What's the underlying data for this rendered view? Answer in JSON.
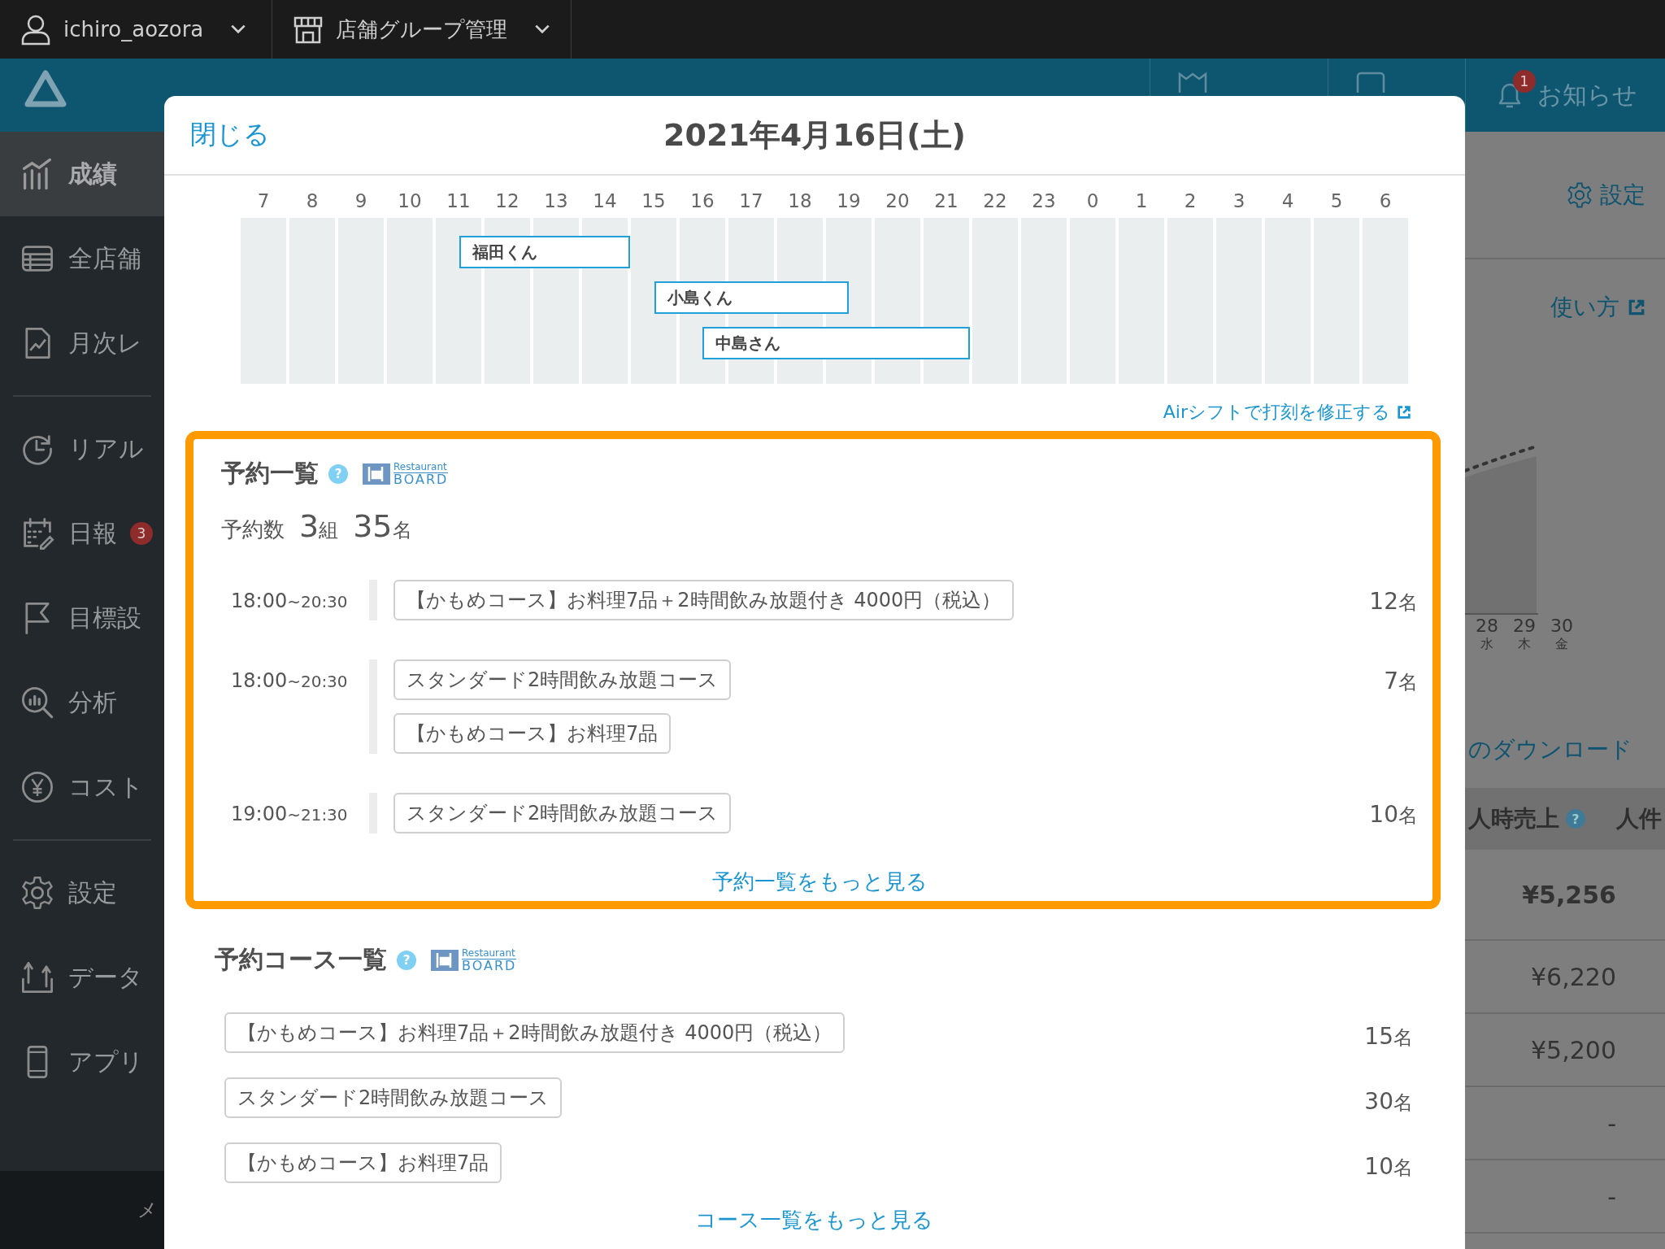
{
  "top_bar": {
    "user": "ichiro_aozora",
    "group": "店舗グループ管理"
  },
  "header": {
    "links": [
      {
        "kind": "guide"
      },
      {
        "kind": "help"
      },
      {
        "label": "お知らせ",
        "kind": "bell",
        "badge": "1"
      }
    ]
  },
  "sidebar": {
    "groups": [
      [
        {
          "label": "成績",
          "kind": "chart",
          "selected": true
        },
        {
          "label": "全店舗",
          "kind": "table",
          "selected": false
        },
        {
          "label": "月次レ",
          "kind": "report",
          "selected": false
        }
      ],
      [
        {
          "label": "リアル",
          "kind": "clock",
          "selected": false
        },
        {
          "label": "日報",
          "kind": "calendar",
          "selected": false,
          "badge": "3"
        },
        {
          "label": "目標設",
          "kind": "flag",
          "selected": false
        },
        {
          "label": "分析",
          "kind": "analysis",
          "selected": false
        },
        {
          "label": "コスト",
          "kind": "yen",
          "selected": false
        }
      ],
      [
        {
          "label": "設定",
          "kind": "gear",
          "selected": false
        },
        {
          "label": "データ",
          "kind": "export",
          "selected": false
        },
        {
          "label": "アプリ",
          "kind": "phone",
          "selected": false
        }
      ]
    ],
    "footer": "メ"
  },
  "background": {
    "settings": "設定",
    "howto": "使い方",
    "days": [
      {
        "day": "28",
        "weekday": "水"
      },
      {
        "day": "29",
        "weekday": "木"
      },
      {
        "day": "30",
        "weekday": "金"
      }
    ],
    "download": "のダウンロード",
    "table": {
      "columns": [
        {
          "label": "人時売上",
          "help": "?"
        },
        {
          "label": "人件"
        }
      ],
      "rows": [
        {
          "value": "¥5,256",
          "kind": "total"
        },
        {
          "value": "¥6,220",
          "kind": "day"
        },
        {
          "value": "¥5,200",
          "kind": "day"
        },
        {
          "value": "-",
          "kind": "day"
        },
        {
          "value": "-",
          "kind": "day"
        }
      ]
    }
  },
  "modal": {
    "close": "閉じる",
    "title": "2021年4月16日(土)",
    "hours": [
      "7",
      "8",
      "9",
      "10",
      "11",
      "12",
      "13",
      "14",
      "15",
      "16",
      "17",
      "18",
      "19",
      "20",
      "21",
      "22",
      "23",
      "0",
      "1",
      "2",
      "3",
      "4",
      "5",
      "6"
    ],
    "shifts": [
      {
        "name": "福田くん"
      },
      {
        "name": "小島くん"
      },
      {
        "name": "中島さん"
      }
    ],
    "shift_link": "Airシフトで打刻を修正する",
    "reservations": {
      "title": "予約一覧",
      "help": "?",
      "highlighted": true,
      "logo": {
        "top": "Restaurant",
        "bottom": "BOARD"
      },
      "summary_label": "予約数",
      "summary": [
        {
          "number": "3",
          "unit": "組"
        },
        {
          "number": "35",
          "unit": "名"
        }
      ],
      "rows": [
        {
          "start": "18:00",
          "end": "~20:30",
          "courses": [
            "【かもめコース】お料理7品＋2時間飲み放題付き 4000円（税込）"
          ],
          "count": "12",
          "unit": "名"
        },
        {
          "start": "18:00",
          "end": "~20:30",
          "courses": [
            "スタンダード2時間飲み放題コース",
            "【かもめコース】お料理7品"
          ],
          "count": "7",
          "unit": "名"
        },
        {
          "start": "19:00",
          "end": "~21:30",
          "courses": [
            "スタンダード2時間飲み放題コース"
          ],
          "count": "10",
          "unit": "名"
        }
      ],
      "more": "予約一覧をもっと見る"
    },
    "courses": {
      "title": "予約コース一覧",
      "help": "?",
      "logo": {
        "top": "Restaurant",
        "bottom": "BOARD"
      },
      "rows": [
        {
          "course": "【かもめコース】お料理7品＋2時間飲み放題付き 4000円（税込）",
          "count": "15",
          "unit": "名"
        },
        {
          "course": "スタンダード2時間飲み放題コース",
          "count": "30",
          "unit": "名"
        },
        {
          "course": "【かもめコース】お料理7品",
          "count": "10",
          "unit": "名"
        }
      ],
      "more": "コース一覧をもっと見る"
    }
  }
}
